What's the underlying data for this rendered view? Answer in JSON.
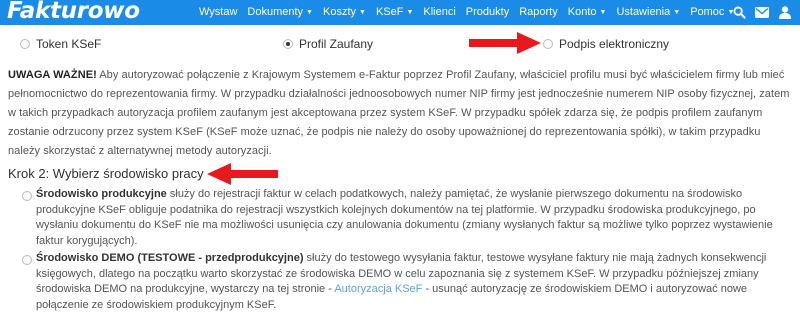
{
  "header": {
    "logo": "Fakturowo",
    "nav": [
      {
        "label": "Wystaw",
        "dropdown": false
      },
      {
        "label": "Dokumenty",
        "dropdown": true
      },
      {
        "label": "Koszty",
        "dropdown": true
      },
      {
        "label": "KSeF",
        "dropdown": true
      },
      {
        "label": "Klienci",
        "dropdown": false
      },
      {
        "label": "Produkty",
        "dropdown": false
      },
      {
        "label": "Raporty",
        "dropdown": false
      },
      {
        "label": "Konto",
        "dropdown": true
      },
      {
        "label": "Ustawienia",
        "dropdown": true
      },
      {
        "label": "Pomoc",
        "dropdown": true
      }
    ],
    "icons": [
      "search-icon",
      "envelope-icon",
      "user-icon"
    ],
    "bar_color": "#1a8be6"
  },
  "auth_methods": {
    "options": [
      {
        "label": "Token KSeF",
        "selected": false
      },
      {
        "label": "Profil Zaufany",
        "selected": true
      },
      {
        "label": "Podpis elektroniczny",
        "selected": false
      }
    ]
  },
  "warning": {
    "title": "UWAGA WAŻNE!",
    "text": " Aby autoryzować połączenie z Krajowym Systemem e-Faktur poprzez Profil Zaufany, właściciel profilu musi być właścicielem firmy lub mieć pełnomocnictwo do reprezentowania firmy. W przypadku działalności jednoosobowych numer NIP firmy jest jednocześnie numerem NIP osoby fizycznej, zatem w takich przypadkach autoryzacja profilem zaufanym jest akceptowana przez system KSeF. W przypadku spółek zdarza się, że podpis profilem zaufanym zostanie odrzucony przez system KSeF (KSeF może uznać, że podpis nie należy do osoby upoważnionej do reprezentowania spółki), w takim przypadku należy skorzystać z alternatywnej metody autoryzacji."
  },
  "step2": {
    "heading": "Krok 2: Wybierz środowisko pracy"
  },
  "environments": {
    "production": {
      "name": "Środowisko produkcyjne",
      "text": " służy do rejestracji faktur w celach podatkowych, należy pamiętać, że wysłanie pierwszego dokumentu na środowisko produkcyjne KSeF obliguje podatnika do rejestracji wszystkich kolejnych dokumentów na tej platformie. W przypadku środowiska produkcyjnego, po wysłaniu dokumentu do KSeF nie ma możliwości usunięcia czy anulowania dokumentu (zmiany wysłanych faktur są możliwe tylko poprzez wystawienie faktur korygujących).",
      "selected": false
    },
    "demo": {
      "name": "Środowisko DEMO (TESTOWE - przedprodukcyjne)",
      "text_before": " służy do testowego wysyłania faktur, testowe wysyłane faktury nie mają żadnych konsekwencji księgowych, dlatego na początku warto skorzystać ze środowiska DEMO w celu zapoznania się z systemem KSeF. W przypadku późniejszej zmiany środowiska DEMO na produkcyjne, wystarczy na tej stronie - ",
      "link": "Autoryzacja KSeF",
      "text_after": " - usunąć autoryzację ze środowiskiem DEMO i autoryzować nowe połączenie ze środowiskiem produkcyjnym KSeF.",
      "selected": false
    }
  },
  "colors": {
    "arrow": "#e8191c",
    "link": "#5aa6d6"
  }
}
